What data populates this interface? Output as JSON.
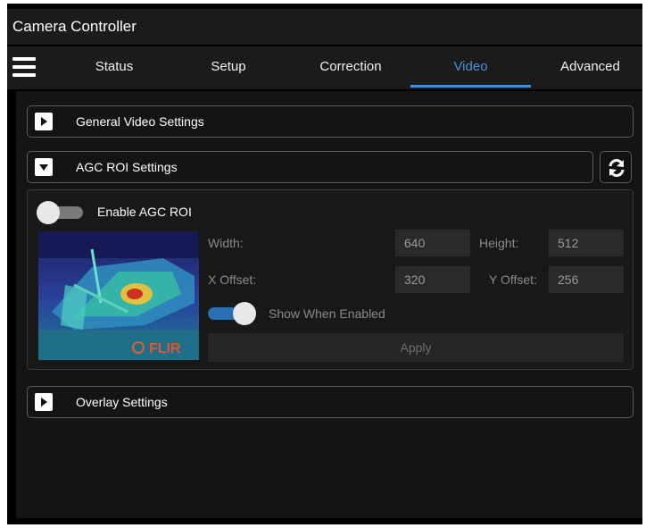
{
  "window": {
    "title": "Camera Controller"
  },
  "nav": {
    "menu_icon": "hamburger-menu-icon",
    "tabs": [
      {
        "label": "Status",
        "active": false
      },
      {
        "label": "Setup",
        "active": false
      },
      {
        "label": "Correction",
        "active": false
      },
      {
        "label": "Video",
        "active": true
      },
      {
        "label": "Advanced",
        "active": false
      }
    ]
  },
  "sections": {
    "general_video": {
      "label": "General Video Settings",
      "expanded": false
    },
    "agc_roi": {
      "label": "AGC ROI Settings",
      "expanded": true,
      "refresh_icon": "refresh-icon"
    },
    "overlay": {
      "label": "Overlay Settings",
      "expanded": false
    }
  },
  "agc_roi": {
    "enable_label": "Enable AGC ROI",
    "enable_on": false,
    "width_label": "Width:",
    "width_value": "640",
    "height_label": "Height:",
    "height_value": "512",
    "x_offset_label": "X Offset:",
    "x_offset_value": "320",
    "y_offset_label": "Y Offset:",
    "y_offset_value": "256",
    "show_when_enabled_label": "Show When Enabled",
    "show_when_enabled_on": true,
    "apply_label": "Apply",
    "preview_logo_text": "FLIR"
  },
  "colors": {
    "accent": "#3d8fe0",
    "background": "#141414",
    "titlebar": "#1b1b1b",
    "toggle_on": "#2a6fb0",
    "toggle_off": "#7a7a7a"
  }
}
